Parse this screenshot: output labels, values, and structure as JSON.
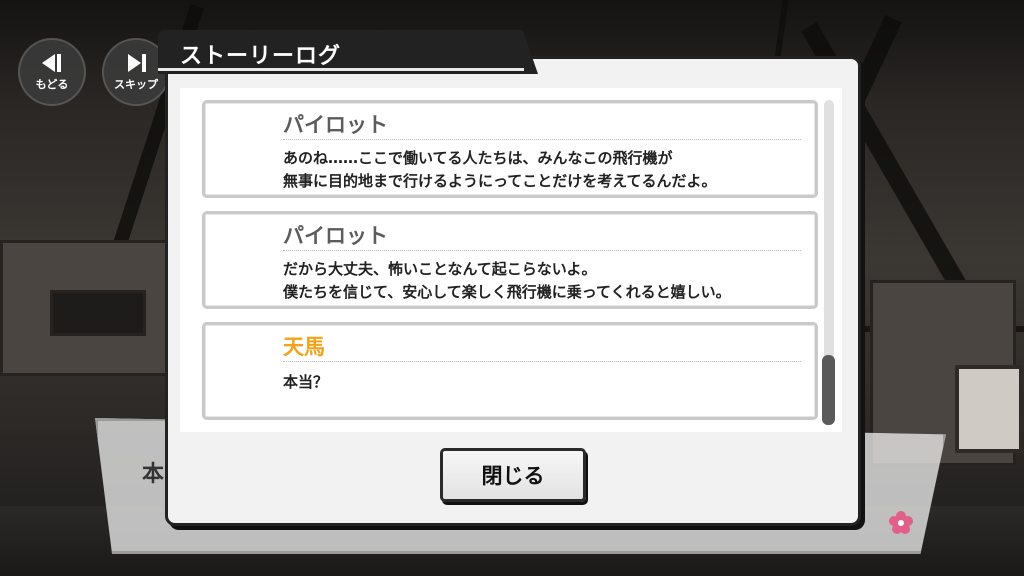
{
  "controls": {
    "back": {
      "label": "もどる",
      "icon": "rewind-icon"
    },
    "skip": {
      "label": "スキップ",
      "icon": "skip-forward-icon"
    }
  },
  "dialog": {
    "title": "ストーリーログ",
    "close_label": "閉じる"
  },
  "log": [
    {
      "speaker": "パイロット",
      "highlight": false,
      "lines": [
        "あのね……ここで働いてる人たちは、みんなこの飛行機が",
        "無事に目的地まで行けるようにってことだけを考えてるんだよ。"
      ]
    },
    {
      "speaker": "パイロット",
      "highlight": false,
      "lines": [
        "だから大丈夫、怖いことなんて起こらないよ。",
        "僕たちを信じて、安心して楽しく飛行機に乗ってくれると嬉しい。"
      ]
    },
    {
      "speaker": "天馬",
      "highlight": true,
      "lines": [
        "本当？"
      ]
    }
  ],
  "message_window": {
    "name_partial": "本"
  },
  "colors": {
    "highlight_speaker": "#f3a21a",
    "speaker": "#5c5c5c",
    "sakura": "#e0608a"
  }
}
